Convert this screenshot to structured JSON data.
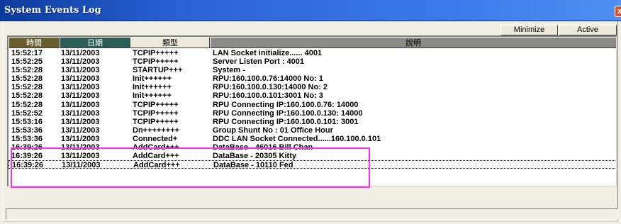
{
  "window": {
    "title": "System Events Log",
    "close_glyph": "x"
  },
  "toolbar": {
    "minimize_label": "Minimize",
    "active_label": "Active"
  },
  "table": {
    "headers": {
      "time": "時間",
      "date": "日期",
      "type": "類型",
      "description": "說明"
    },
    "rows": [
      {
        "time": "15:52:17",
        "date": "13/11/2003",
        "type": "TCPIP+++++",
        "description": "LAN Socket initialize...... 4001"
      },
      {
        "time": "15:52:25",
        "date": "13/11/2003",
        "type": "TCPIP+++++",
        "description": "Server Listen Port : 4001"
      },
      {
        "time": "15:52:28",
        "date": "13/11/2003",
        "type": "STARTUP+++",
        "description": "System -"
      },
      {
        "time": "15:52:28",
        "date": "13/11/2003",
        "type": "Init++++++",
        "description": "RPU:160.100.0.76:14000 No: 1"
      },
      {
        "time": "15:52:28",
        "date": "13/11/2003",
        "type": "Init++++++",
        "description": "RPU:160.100.0.130:14000 No: 2"
      },
      {
        "time": "15:52:28",
        "date": "13/11/2003",
        "type": "Init++++++",
        "description": "RPU:160.100.0.101:3001 No: 3"
      },
      {
        "time": "15:52:28",
        "date": "13/11/2003",
        "type": "TCPIP+++++",
        "description": "RPU Connecting IP:160.100.0.76: 14000"
      },
      {
        "time": "15:52:52",
        "date": "13/11/2003",
        "type": "TCPIP+++++",
        "description": "RPU Connecting IP:160.100.0.130: 14000"
      },
      {
        "time": "15:53:16",
        "date": "13/11/2003",
        "type": "TCPIP+++++",
        "description": "RPU Connecting IP:160.100.0.101: 3001"
      },
      {
        "time": "15:53:36",
        "date": "13/11/2003",
        "type": "Dn++++++++",
        "description": "Group Shunt No : 01 Office Hour"
      },
      {
        "time": "15:53:36",
        "date": "13/11/2003",
        "type": "Connected+",
        "description": "DDC LAN Socket Connected......160.100.0.101"
      },
      {
        "time": "16:39:26",
        "date": "13/11/2003",
        "type": "AddCard+++",
        "description": "DataBase - 46016 Bill Chan"
      },
      {
        "time": "16:39:26",
        "date": "13/11/2003",
        "type": "AddCard+++",
        "description": "DataBase - 20305 Kitty"
      },
      {
        "time": "16:39:26",
        "date": "13/11/2003",
        "type": "AddCard+++",
        "description": "DataBase - 10110 Fed"
      }
    ]
  },
  "colors": {
    "highlight": "#ff2df0",
    "title_bar": "#2a63d6",
    "header_time_bg": "#6a5f2c",
    "header_date_bg": "#2a5e56"
  }
}
